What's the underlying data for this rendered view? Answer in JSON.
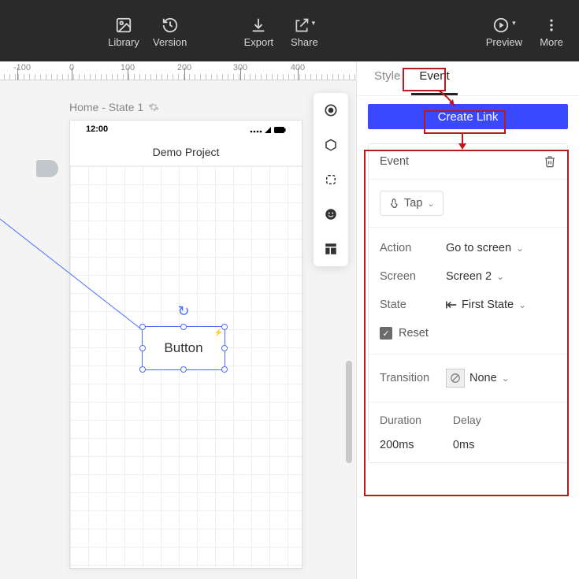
{
  "toolbar": {
    "library": "Library",
    "version": "Version",
    "export": "Export",
    "share": "Share",
    "preview": "Preview",
    "more": "More"
  },
  "ruler": {
    "n100": "-100",
    "p0": "0",
    "p100": "100",
    "p200": "200",
    "p300": "300",
    "p400": "400"
  },
  "breadcrumb": "Home - State 1",
  "device": {
    "time": "12:00",
    "signals": "▪▪▪ 📶 ■",
    "title": "Demo Project"
  },
  "button": "Button",
  "panel": {
    "tabs": {
      "style": "Style",
      "event": "Event"
    },
    "create": "Create Link",
    "event_header": "Event",
    "trigger": "Tap",
    "action_label": "Action",
    "action_value": "Go to screen",
    "screen_label": "Screen",
    "screen_value": "Screen 2",
    "state_label": "State",
    "state_value": "First State",
    "reset_label": "Reset",
    "transition_label": "Transition",
    "transition_value": "None",
    "duration_label": "Duration",
    "duration_value": "200ms",
    "delay_label": "Delay",
    "delay_value": "0ms"
  },
  "icons": {
    "library": "image-icon",
    "version": "history-icon",
    "export": "download-icon",
    "share": "share-icon",
    "preview": "play-icon",
    "more": "more-icon"
  }
}
